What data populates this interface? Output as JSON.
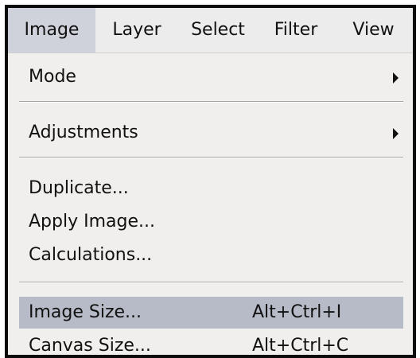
{
  "menubar": {
    "items": [
      {
        "label": "Image"
      },
      {
        "label": "Layer"
      },
      {
        "label": "Select"
      },
      {
        "label": "Filter"
      },
      {
        "label": "View"
      }
    ]
  },
  "dropdown": {
    "items": [
      {
        "label": "Mode"
      },
      {
        "label": "Adjustments"
      },
      {
        "label": "Duplicate..."
      },
      {
        "label": "Apply Image..."
      },
      {
        "label": "Calculations..."
      },
      {
        "label": "Image Size...",
        "shortcut": "Alt+Ctrl+I"
      },
      {
        "label": "Canvas Size...",
        "shortcut": "Alt+Ctrl+C"
      }
    ]
  },
  "colors": {
    "frame": "#0b0b0b",
    "menu_bg": "#f0efed",
    "active_menu_bg": "#cfd1db",
    "highlight_bg": "#b7bac7"
  }
}
